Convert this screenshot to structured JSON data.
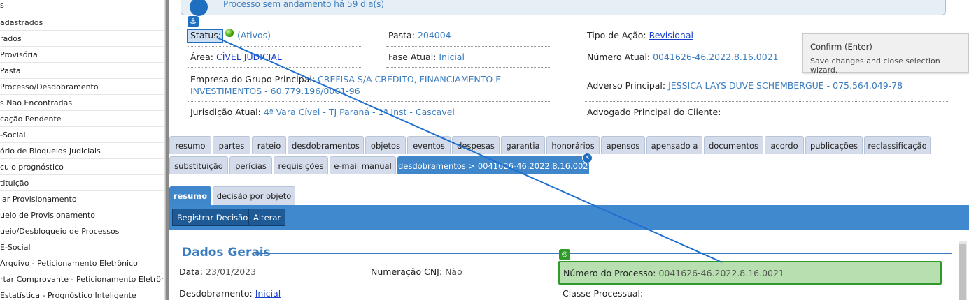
{
  "sidebar": {
    "items": [
      "s",
      "adastrados",
      "rados",
      " Provisória",
      "Pasta",
      "Processo/Desdobramento",
      "s Não Encontradas",
      "cação Pendente",
      "-Social",
      "ório de Bloqueios Judiciais",
      "culo prognóstico",
      "tituição",
      "lar Provisionamento",
      "ueio de Provisionamento",
      "ueio/Desbloqueio de Processos",
      " E-Social",
      " Arquivo - Peticionamento Eletrônico",
      "rtar Comprovante - Peticionamento Eletrônico",
      "Estatística - Prognóstico Inteligente"
    ]
  },
  "banner": {
    "text": "Processo sem andamento há 59 dia(s)"
  },
  "info": {
    "status_label": "Status:",
    "status_value": "(Ativos)",
    "pasta_label": "Pasta:",
    "pasta_value": "204004",
    "tipo_label": "Tipo de Ação:",
    "tipo_value": "Revisional",
    "area_label": "Área:",
    "area_value": "CÍVEL JUDICIAL",
    "fase_label": "Fase Atual:",
    "fase_value": "Inicial",
    "numero_label": "Número Atual:",
    "numero_value": "0041626-46.2022.8.16.0021",
    "empresa_label": "Empresa do Grupo Principal:",
    "empresa_value_1": "CREFISA S/A CRÉDITO, FINANCIAMENTO E",
    "empresa_value_2": "INVESTIMENTOS - 60.779.196/0001-96",
    "adverso_label": "Adverso Principal:",
    "adverso_value": "JESSICA LAYS DUVE SCHEMBERGUE - 075.564.049-78",
    "jurisdicao_label": "Jurisdição Atual:",
    "jurisdicao_value": "4ª Vara Cível - TJ Paraná - 1ª Inst - Cascavel",
    "advogado_label": "Advogado Principal do Cliente:"
  },
  "tooltip": {
    "title": "Confirm (Enter)",
    "body": "Save changes and close selection wizard."
  },
  "tabs_row1": [
    "resumo",
    "partes",
    "rateio",
    "desdobramentos",
    "objetos",
    "eventos",
    "despesas",
    "garantia",
    "honorários",
    "apensos",
    "apensado a",
    "documentos",
    "acordo",
    "publicações",
    "reclassificação"
  ],
  "tabs_row2": [
    "substituição",
    "perícias",
    "requisições",
    "e-mail manual",
    "desdobramentos > 0041626-46.2022.8.16.0021"
  ],
  "tab_close": "×",
  "subtabs": [
    "resumo",
    "decisão por objeto"
  ],
  "toolbar": {
    "registrar": "Registrar Decisão",
    "alterar": "Alterar"
  },
  "section": {
    "title": "Dados Gerais",
    "data_label": "Data:",
    "data_value": "23/01/2023",
    "cnj_label": "Numeração CNJ:",
    "cnj_value": "Não",
    "processo_label": "Número do Processo:",
    "processo_value": "0041626-46.2022.8.16.0021",
    "desdobramento_label": "Desdobramento:",
    "desdobramento_value": "Inicial",
    "classe_label": "Classe Processual:"
  },
  "icons": {
    "anchor": "anchor-icon",
    "target": "target-icon",
    "status": "status-green-dot-icon"
  },
  "colors": {
    "accent": "#3b7dbf",
    "toolbar": "#4189cf",
    "green_field": "#b7dfb0",
    "green_border": "#2f9a2a",
    "link": "#1a3fcf"
  }
}
